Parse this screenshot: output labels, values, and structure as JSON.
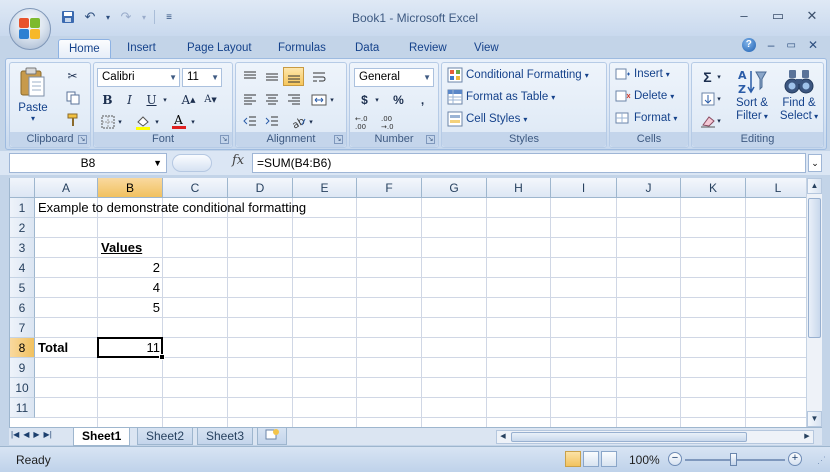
{
  "window": {
    "title": "Book1 - Microsoft Excel",
    "controls": [
      "–",
      "▭",
      "✕"
    ]
  },
  "ribbon_tabs": [
    {
      "label": "Home",
      "active": true
    },
    {
      "label": "Insert"
    },
    {
      "label": "Page Layout"
    },
    {
      "label": "Formulas"
    },
    {
      "label": "Data"
    },
    {
      "label": "Review"
    },
    {
      "label": "View"
    }
  ],
  "groups": {
    "clipboard": {
      "label": "Clipboard",
      "paste": "Paste"
    },
    "font": {
      "label": "Font",
      "font_name": "Calibri",
      "font_size": "11"
    },
    "alignment": {
      "label": "Alignment"
    },
    "number": {
      "label": "Number",
      "format": "General",
      "currency": "$",
      "percent": "%",
      "comma": ","
    },
    "styles": {
      "label": "Styles",
      "conditional_formatting": "Conditional Formatting",
      "format_as_table": "Format as Table",
      "cell_styles": "Cell Styles"
    },
    "cells": {
      "label": "Cells",
      "insert": "Insert",
      "delete": "Delete",
      "format": "Format"
    },
    "editing": {
      "label": "Editing",
      "sort_filter_1": "Sort &",
      "sort_filter_2": "Filter",
      "find_select_1": "Find &",
      "find_select_2": "Select"
    }
  },
  "formula_bar": {
    "name_box": "B8",
    "fx": "fx",
    "formula": "=SUM(B4:B6)"
  },
  "grid": {
    "columns": [
      "A",
      "B",
      "C",
      "D",
      "E",
      "F",
      "G",
      "H",
      "I",
      "J",
      "K",
      "L"
    ],
    "rows": [
      "1",
      "2",
      "3",
      "4",
      "5",
      "6",
      "7",
      "8",
      "9",
      "10",
      "11"
    ],
    "selected_col": "B",
    "selected_row": "8",
    "cells": {
      "A1": "Example to demonstrate conditional formatting",
      "B3": "Values",
      "B4": "2",
      "B5": "4",
      "B6": "5",
      "A8": "Total",
      "B8": "11"
    }
  },
  "sheets": [
    {
      "label": "Sheet1",
      "active": true
    },
    {
      "label": "Sheet2"
    },
    {
      "label": "Sheet3"
    }
  ],
  "status": {
    "text": "Ready",
    "zoom": "100%"
  },
  "colors": {
    "accent": "#15428b",
    "selected_header": "#f1c15f"
  }
}
